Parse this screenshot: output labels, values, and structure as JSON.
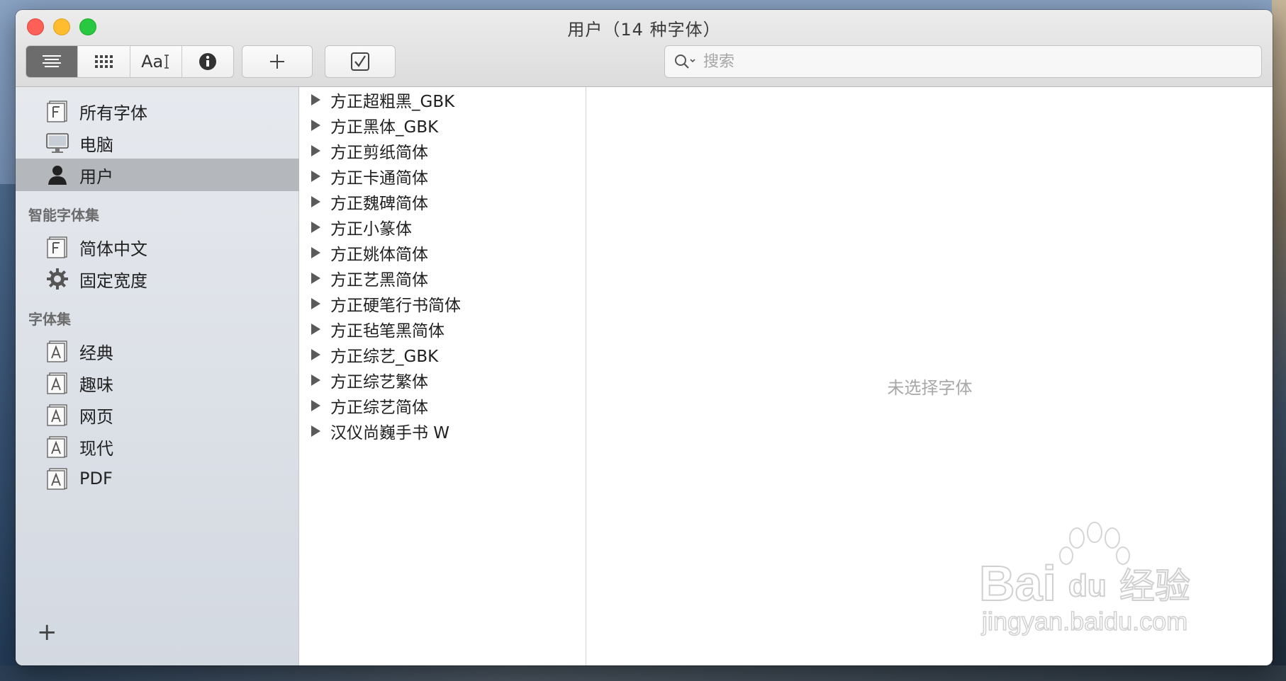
{
  "window": {
    "title": "用户（14 种字体）"
  },
  "toolbar": {
    "view_modes": [
      {
        "name": "list-view",
        "icon": "list-lines-icon",
        "active": true
      },
      {
        "name": "grid-view",
        "icon": "grid-dots-icon",
        "active": false
      },
      {
        "name": "sample-view",
        "label": "Aa",
        "icon": "text-cursor-icon",
        "active": false
      },
      {
        "name": "info-view",
        "icon": "info-icon",
        "active": false
      }
    ],
    "add_button_icon": "plus-icon",
    "validate_button_icon": "checkbox-icon",
    "search_placeholder": "搜索"
  },
  "sidebar": {
    "library_items": [
      {
        "label": "所有字体",
        "icon": "font-f-icon",
        "selected": false
      },
      {
        "label": "电脑",
        "icon": "computer-icon",
        "selected": false
      },
      {
        "label": "用户",
        "icon": "user-icon",
        "selected": true
      }
    ],
    "smart_header": "智能字体集",
    "smart_items": [
      {
        "label": "简体中文",
        "icon": "font-f-icon"
      },
      {
        "label": "固定宽度",
        "icon": "gear-icon"
      }
    ],
    "collections_header": "字体集",
    "collection_items": [
      {
        "label": "经典",
        "icon": "font-a-icon"
      },
      {
        "label": "趣味",
        "icon": "font-a-icon"
      },
      {
        "label": "网页",
        "icon": "font-a-icon"
      },
      {
        "label": "现代",
        "icon": "font-a-icon"
      },
      {
        "label": "PDF",
        "icon": "font-a-icon"
      }
    ],
    "add_label": "+"
  },
  "font_families": [
    "方正超粗黑_GBK",
    "方正黑体_GBK",
    "方正剪纸简体",
    "方正卡通简体",
    "方正魏碑简体",
    "方正小篆体",
    "方正姚体简体",
    "方正艺黑简体",
    "方正硬笔行书简体",
    "方正毡笔黑简体",
    "方正综艺_GBK",
    "方正综艺繁体",
    "方正综艺简体",
    "汉仪尚巍手书 W"
  ],
  "preview": {
    "empty_text": "未选择字体"
  },
  "watermark": {
    "brand": "Bai",
    "brand_suffix": "经验",
    "url": "jingyan.baidu.com",
    "du": "du"
  },
  "colors": {
    "selected_row": "#b4b7bc",
    "close": "#fe5f57",
    "minimize": "#febc2e",
    "maximize": "#28c840"
  }
}
